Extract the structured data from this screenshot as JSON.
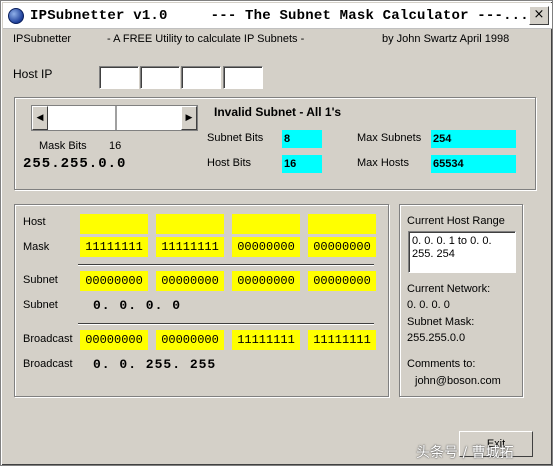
{
  "window": {
    "title": "IPSubnetter v1.0     --- The Subnet Mask Calculator ---...",
    "close_glyph": "×"
  },
  "header": {
    "app_name": "IPSubnetter",
    "tagline": "- A FREE Utility to calculate IP Subnets -",
    "author": "by John Swartz  April 1998"
  },
  "host_ip": {
    "label": "Host IP",
    "octets": [
      "",
      "",
      "",
      ""
    ]
  },
  "mask": {
    "bits_label": "Mask Bits",
    "bits_value": "16",
    "dotted": "255.255.0.0",
    "slider_left_glyph": "◀",
    "slider_right_glyph": "▶"
  },
  "subnet_info": {
    "status": "Invalid Subnet - All 1's",
    "subnet_bits_label": "Subnet Bits",
    "subnet_bits_value": "8",
    "host_bits_label": "Host Bits",
    "host_bits_value": "16",
    "max_subnets_label": "Max Subnets",
    "max_subnets_value": "254",
    "max_hosts_label": "Max Hosts",
    "max_hosts_value": "65534"
  },
  "binary": {
    "host_label": "Host",
    "host_octets": [
      "",
      "",
      "",
      ""
    ],
    "mask_label": "Mask",
    "mask_octets": [
      "11111111",
      "11111111",
      "00000000",
      "00000000"
    ],
    "subnet_label": "Subnet",
    "subnet_octets": [
      "00000000",
      "00000000",
      "00000000",
      "00000000"
    ],
    "subnet_dotted_label": "Subnet",
    "subnet_dotted": "0. 0. 0. 0",
    "broadcast_label": "Broadcast",
    "broadcast_octets": [
      "00000000",
      "00000000",
      "11111111",
      "11111111"
    ],
    "broadcast_dotted_label": "Broadcast",
    "broadcast_dotted": "0. 0. 255. 255"
  },
  "side_panel": {
    "range_label": "Current Host Range",
    "range_line1": "0. 0. 0. 1 to  0. 0.",
    "range_line2": "255. 254",
    "network_label": "Current Network:",
    "network_value": "0. 0. 0. 0",
    "mask_label": "Subnet Mask:",
    "mask_value": "255.255.0.0",
    "comments_label": "Comments to:",
    "comments_value": "john@boson.com"
  },
  "exit_label": "Exit",
  "watermark": "头条号 / 曹城拓",
  "colors": {
    "bits_highlight": "#ffff00",
    "info_highlight": "#00ffff",
    "face": "#d4d0c8"
  }
}
